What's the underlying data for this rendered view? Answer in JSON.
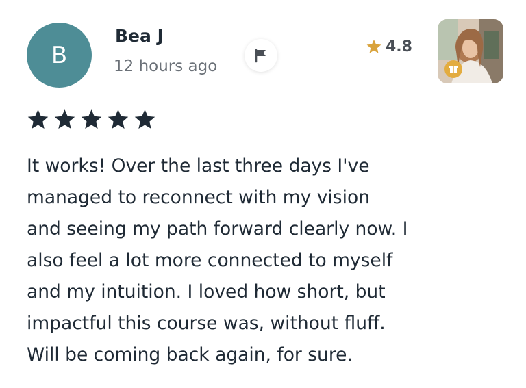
{
  "review": {
    "author_initial": "B",
    "author_name": "Bea J",
    "posted": "12 hours ago",
    "course_rating": "4.8",
    "stars_given": 5,
    "body_lines": [
      "It works! Over the last three days I've",
      "managed to reconnect with my vision",
      "and seeing my path forward clearly now. I",
      "also feel a lot more connected to myself",
      "and my intuition. I loved how short, but",
      "impactful this course was, without fluff.",
      "Will be coming back again, for sure."
    ]
  },
  "icons": {
    "flag": "flag-icon",
    "rating_star": "star-icon",
    "badge": "gift-icon"
  },
  "colors": {
    "avatar_bg": "#4e8d96",
    "star_dark": "#1f2a35",
    "star_gold": "#d9a33c",
    "badge_bg": "#e3ac40"
  }
}
